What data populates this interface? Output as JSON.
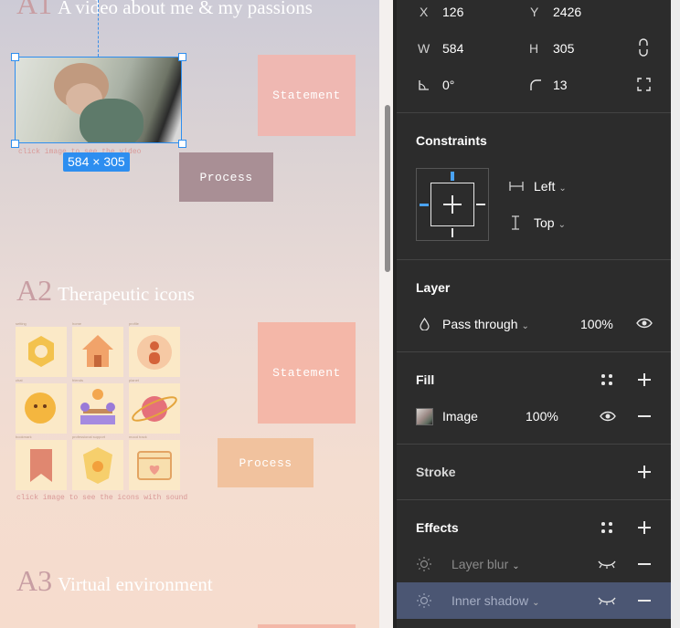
{
  "canvas": {
    "sections": [
      {
        "num": "A1",
        "title": "A video about me & my passions"
      },
      {
        "num": "A2",
        "title": "Therapeutic icons"
      },
      {
        "num": "A3",
        "title": "Virtual environment"
      }
    ],
    "video_caption": "click image to see the video",
    "selection_size": "584 × 305",
    "statement_label": "Statement",
    "process_label": "Process",
    "icons_caption": "click image to see the icons with sound",
    "icon_labels": [
      "setting",
      "home",
      "profile",
      "chat",
      "friends",
      "planet",
      "bookmark",
      "professional support",
      "mood track"
    ]
  },
  "panel": {
    "x_label": "X",
    "x_value": "126",
    "y_label": "Y",
    "y_value": "2426",
    "w_label": "W",
    "w_value": "584",
    "h_label": "H",
    "h_value": "305",
    "rotation_value": "0°",
    "radius_value": "13",
    "constraints": {
      "title": "Constraints",
      "horizontal": "Left",
      "vertical": "Top"
    },
    "layer": {
      "title": "Layer",
      "blend": "Pass through",
      "opacity": "100%"
    },
    "fill": {
      "title": "Fill",
      "type": "Image",
      "opacity": "100%"
    },
    "stroke": {
      "title": "Stroke"
    },
    "effects": {
      "title": "Effects",
      "items": [
        "Layer blur",
        "Inner shadow"
      ]
    }
  },
  "colors": {
    "selection": "#2d8ef0",
    "statement_box": "#f0b2ad",
    "process_box": "#a88c92",
    "panel_bg": "#2c2c2c",
    "effects_highlight": "#4b5673"
  }
}
